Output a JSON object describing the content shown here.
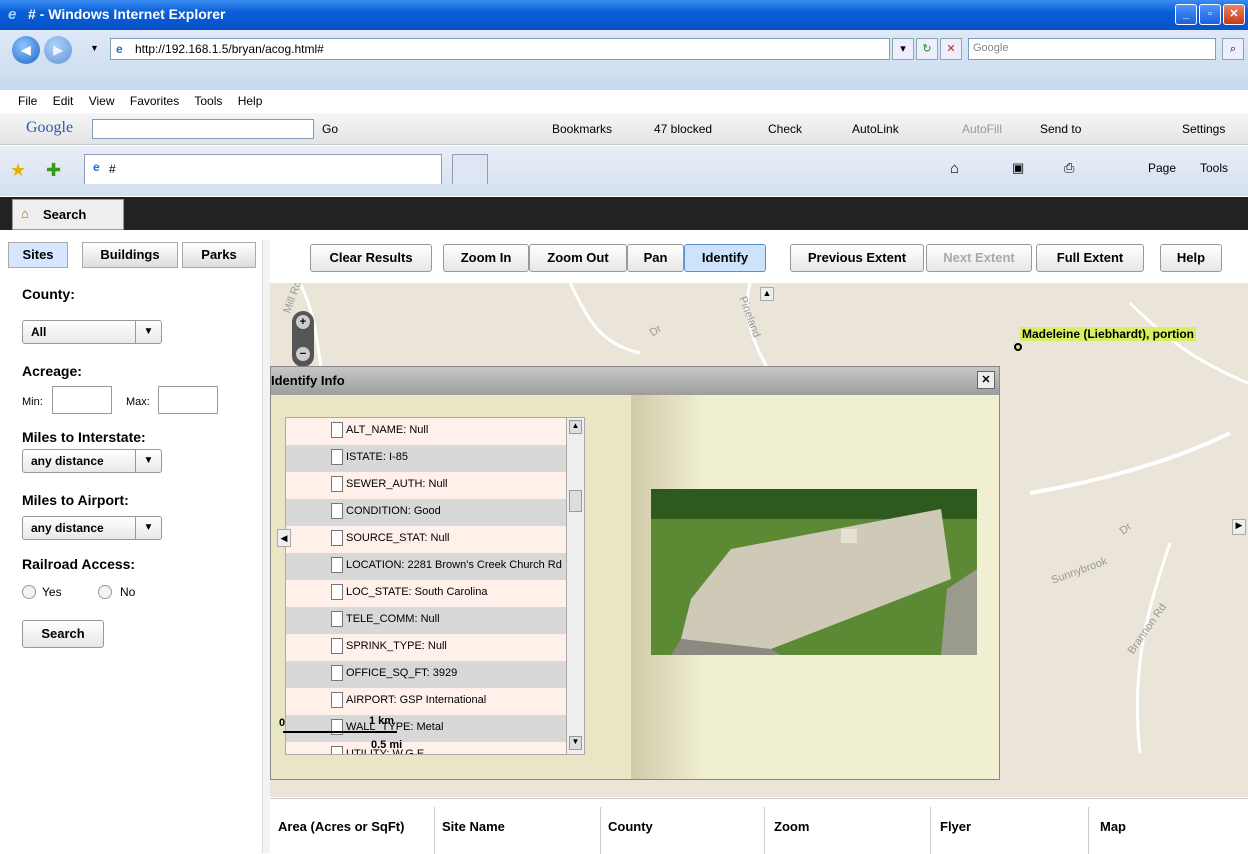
{
  "window": {
    "title": "# - Windows Internet Explorer"
  },
  "address": {
    "url": "http://192.168.1.5/bryan/acog.html#",
    "search_placeholder": "Google"
  },
  "menu": [
    "File",
    "Edit",
    "View",
    "Favorites",
    "Tools",
    "Help"
  ],
  "google_toolbar": {
    "logo": "Google",
    "go": "Go",
    "bookmarks": "Bookmarks",
    "blocked": "47 blocked",
    "check": "Check",
    "autolink": "AutoLink",
    "autofill": "AutoFill",
    "sendto": "Send to",
    "settings": "Settings"
  },
  "fav": {
    "tab_title": "#",
    "page": "Page",
    "tools": "Tools"
  },
  "app_tab": "Search",
  "left": {
    "tabs": [
      "Sites",
      "Buildings",
      "Parks"
    ],
    "county_label": "County:",
    "county_value": "All",
    "acreage_label": "Acreage:",
    "min_label": "Min:",
    "max_label": "Max:",
    "interstate_label": "Miles to Interstate:",
    "interstate_value": "any distance",
    "airport_label": "Miles to Airport:",
    "airport_value": "any distance",
    "railroad_label": "Railroad Access:",
    "yes": "Yes",
    "no": "No",
    "search_button": "Search"
  },
  "toolbar": [
    "Clear Results",
    "Zoom In",
    "Zoom Out",
    "Pan",
    "Identify",
    "Previous Extent",
    "Next Extent",
    "Full Extent",
    "Help"
  ],
  "map": {
    "feature_label": "Madeleine (Liebhardt), portion",
    "labels": [
      "Mill Rd",
      "Dr",
      "Pineland",
      "Sunnybrook",
      "Dr",
      "Brannon Rd"
    ],
    "scale_km": "1 km",
    "scale_mi": "0.5 mi",
    "scale_zero": "0"
  },
  "identify": {
    "title": "Identify Info",
    "rows": [
      "ALT_NAME: Null",
      "ISTATE: I-85",
      "SEWER_AUTH: Null",
      "CONDITION: Good",
      "SOURCE_STAT: Null",
      "LOCATION: 2281 Brown's Creek Church Rd",
      "LOC_STATE: South Carolina",
      "TELE_COMM: Null",
      "SPRINK_TYPE: Null",
      "OFFICE_SQ_FT: 3929",
      "AIRPORT: GSP International",
      "WALL_TYPE: Metal",
      "UTILITY: W,G,E"
    ]
  },
  "results": {
    "headers": [
      "Area (Acres or SqFt)",
      "Site Name",
      "County",
      "Zoom",
      "Flyer",
      "Map"
    ]
  },
  "colors": {
    "title_bar": "#0a5fd8",
    "feature": "#d8f060"
  }
}
